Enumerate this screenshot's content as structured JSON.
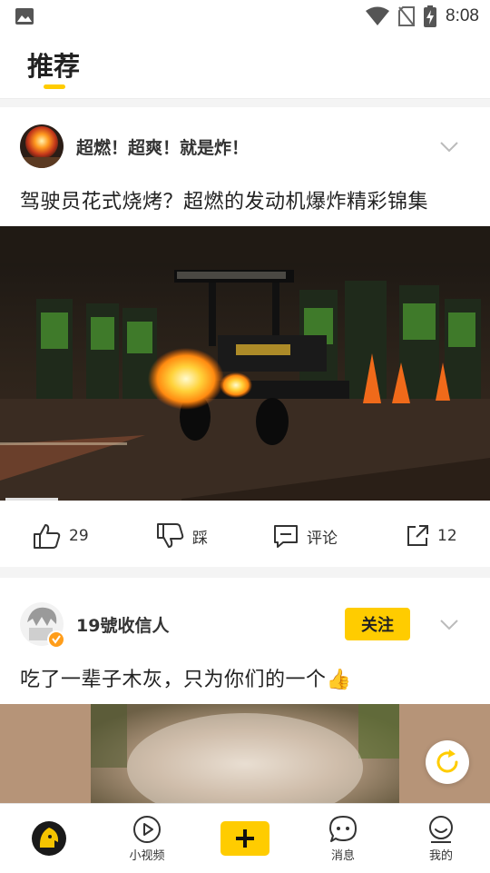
{
  "status_bar": {
    "time": "8:08"
  },
  "header": {
    "active_tab": "推荐"
  },
  "posts": [
    {
      "author": "超燃！超爽！就是炸！",
      "title": "驾驶员花式烧烤？超燃的发动机爆炸精彩锦集",
      "likes": "29",
      "dislike_label": "踩",
      "comment_label": "评论",
      "shares": "12"
    },
    {
      "author": "19號收信人",
      "follow_label": "关注",
      "title": "吃了一辈子木灰，只为你们的一个👍"
    }
  ],
  "bottom_nav": {
    "video_label": "小视频",
    "messages_label": "消息",
    "me_label": "我的"
  },
  "colors": {
    "accent": "#ffcc00"
  }
}
